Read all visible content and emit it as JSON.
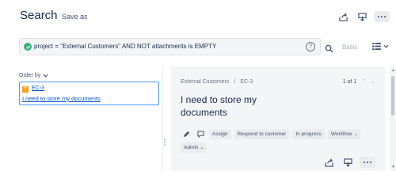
{
  "header": {
    "title": "Search",
    "save_as": "Save as"
  },
  "search": {
    "query": "project = \"External Customers\" AND NOT attachments is EMPTY",
    "help_label": "?",
    "basic_label": "Basic"
  },
  "results": {
    "order_by_label": "Order by",
    "issues": [
      {
        "key": "EC-3",
        "summary": "I need to store my documents"
      }
    ]
  },
  "detail": {
    "project": "External Customers",
    "separator": "/",
    "key": "EC-3",
    "pager": "1 of 1",
    "title": "I need to store my documents",
    "actions": {
      "assign": "Assign",
      "respond": "Respond to customer",
      "status": "In progress",
      "workflow": "Workflow",
      "admin": "Admin"
    }
  },
  "colors": {
    "accent": "#0052cc",
    "success": "#36b37e",
    "issue_type": "#ff9f1a"
  },
  "icons": [
    "check-circle-icon",
    "share-icon",
    "export-icon",
    "more-icon",
    "search-icon",
    "list-view-icon",
    "edit-icon",
    "comment-icon",
    "chevron-down-icon"
  ]
}
